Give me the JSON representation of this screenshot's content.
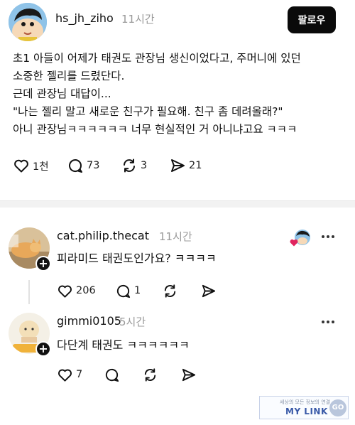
{
  "post": {
    "username": "hs_jh_ziho",
    "time": "11시간",
    "follow_label": "팔로우",
    "lines": [
      "초1 아들이 어제가 태권도 관장님 생신이었다고, 주머니에 있던",
      "소중한 젤리를 드렸단다.",
      "근데 관장님 대답이...",
      "\"나는 젤리 말고 새로운 친구가 필요해. 친구 좀 데려올래?\"",
      "아니 관장님ㅋㅋㅋㅋㅋㅋ 너무 현실적인 거 아니냐고요 ㅋㅋㅋ"
    ],
    "likes": "1천",
    "comments": "73",
    "reposts": "3",
    "shares": "21"
  },
  "replies": [
    {
      "username": "cat.philip.thecat",
      "time": "11시간",
      "text": "피라미드 태권도인가요? ㅋㅋㅋㅋ",
      "likes": "206",
      "comments": "1"
    },
    {
      "username": "gimmi0105",
      "time": "5시간",
      "text": "다단계 태권도 ㅋㅋㅋㅋㅋㅋ",
      "likes": "7"
    }
  ],
  "watermark": {
    "tagline": "세상의 모든 정보의 연결",
    "logo": "MY LINK",
    "go": "GO"
  },
  "colors": {
    "follow_bg": "#0a0a0a",
    "muted": "#9a9a9a",
    "liked_heart": "#e0245e"
  }
}
